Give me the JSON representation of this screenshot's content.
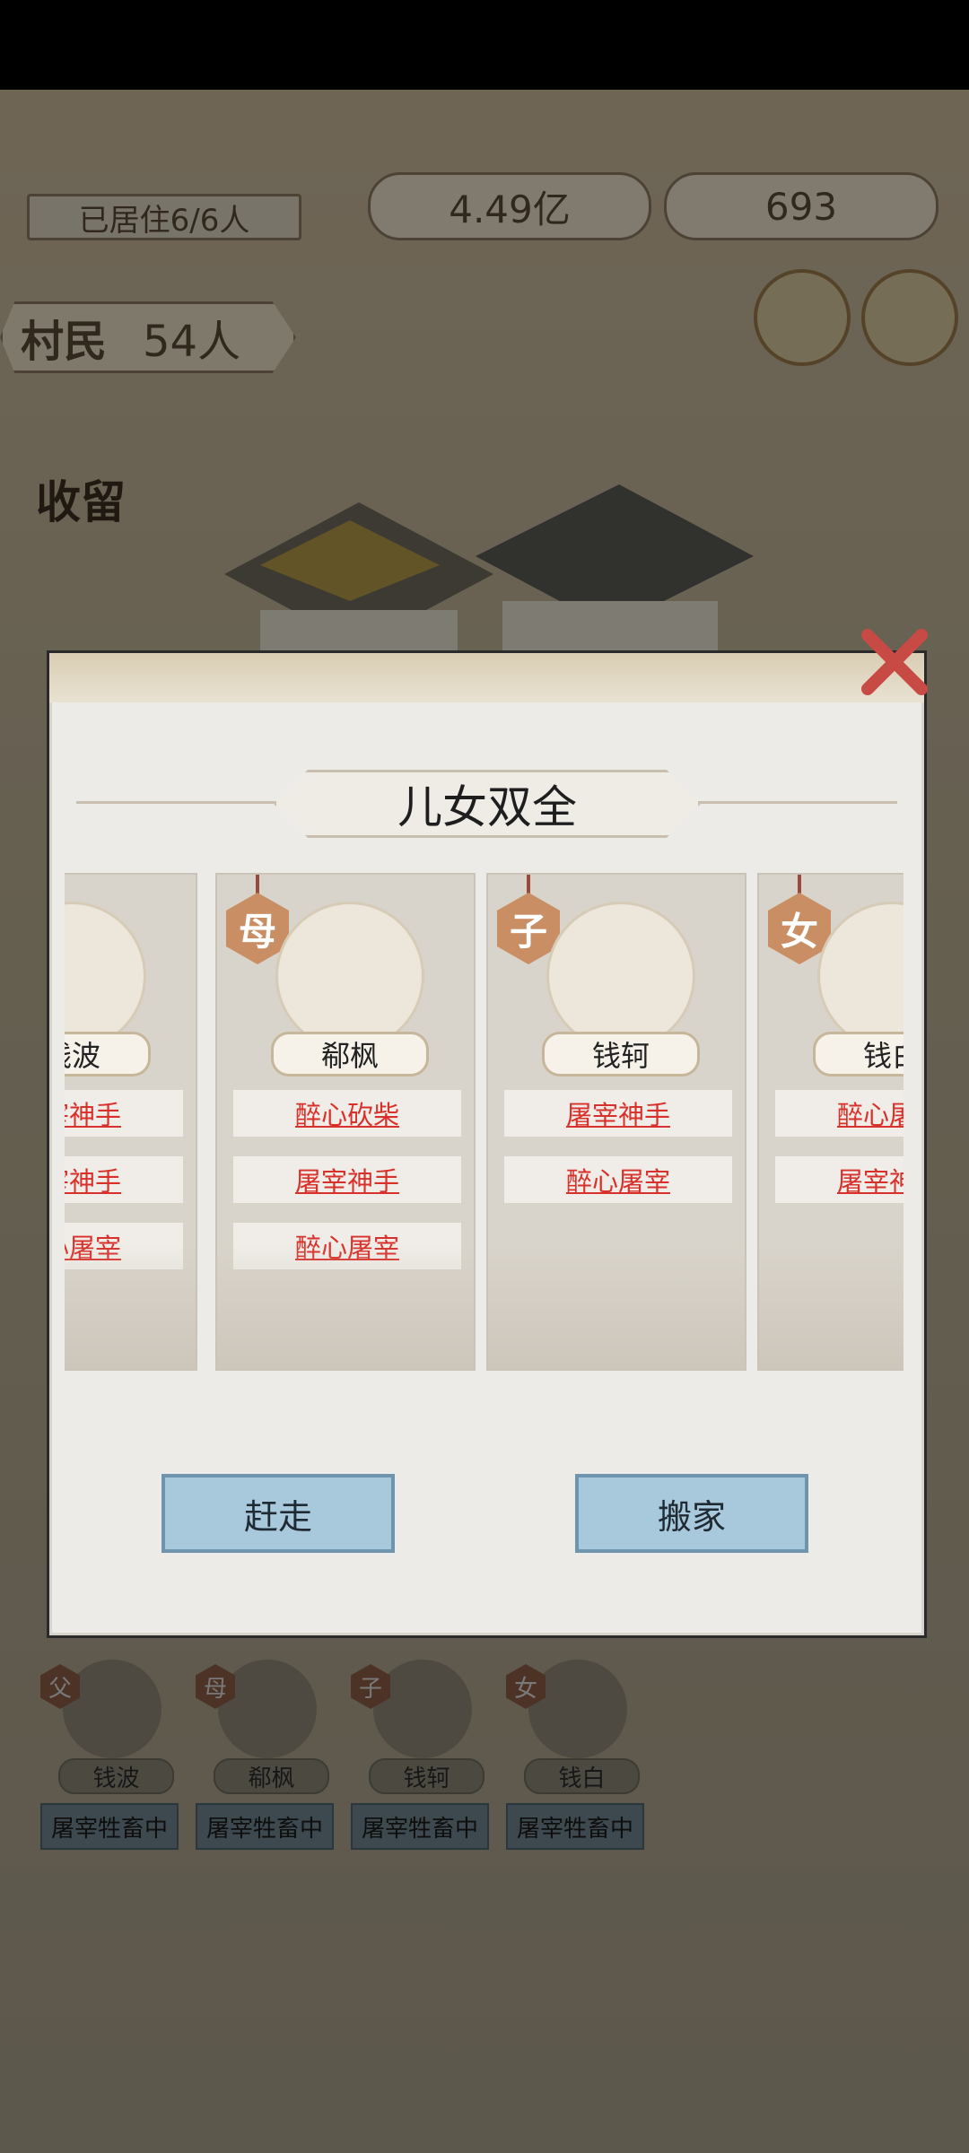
{
  "hud": {
    "resident": "已居住6/6人",
    "coins": "4.49亿",
    "ingots": "693",
    "villager_label": "村民",
    "villager_count": "54人",
    "shelter": "收留"
  },
  "dialog": {
    "title": "儿女双全",
    "cards": [
      {
        "role": "",
        "name": "钱波",
        "traits": [
          "屠宰神手",
          "屠宰神手",
          "醉心屠宰"
        ]
      },
      {
        "role": "母",
        "name": "郗枫",
        "traits": [
          "醉心砍柴",
          "屠宰神手",
          "醉心屠宰"
        ]
      },
      {
        "role": "子",
        "name": "钱轲",
        "traits": [
          "屠宰神手",
          "醉心屠宰"
        ]
      },
      {
        "role": "女",
        "name": "钱白",
        "traits": [
          "醉心屠宰",
          "屠宰神手"
        ]
      }
    ],
    "evict_label": "赶走",
    "move_label": "搬家"
  },
  "family": [
    {
      "role": "父",
      "name": "钱波",
      "status": "屠宰牲畜中"
    },
    {
      "role": "母",
      "name": "郗枫",
      "status": "屠宰牲畜中"
    },
    {
      "role": "子",
      "name": "钱轲",
      "status": "屠宰牲畜中"
    },
    {
      "role": "女",
      "name": "钱白",
      "status": "屠宰牲畜中"
    }
  ],
  "colors": {
    "accent": "#d8302a",
    "button": "#a8c8dc",
    "role_tag": "#c98e64"
  }
}
